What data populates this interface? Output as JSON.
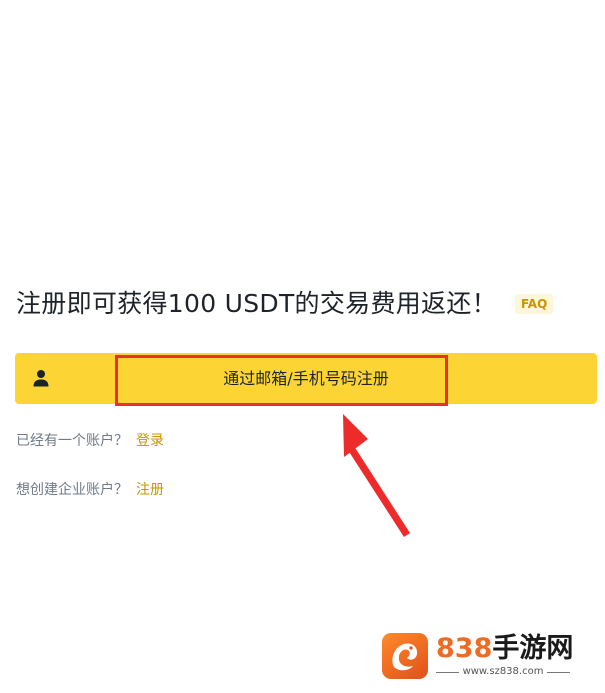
{
  "headline": {
    "text": "注册即可获得100 USDT的交易费用返还！",
    "faq_label": "FAQ"
  },
  "signup": {
    "label": "通过邮箱/手机号码注册",
    "icon": "user-icon"
  },
  "login_prompt": {
    "text": "已经有一个账户？",
    "link": "登录"
  },
  "business_prompt": {
    "text": "想创建企业账户？",
    "link": "注册"
  },
  "watermark": {
    "brand_number": "838",
    "brand_text": "手游网",
    "url": "www.sz838.com"
  },
  "colors": {
    "primary_yellow": "#fcd535",
    "link_gold": "#c99400",
    "highlight_red": "#e8312b",
    "text_dark": "#1e2329",
    "text_muted": "#707a8a"
  }
}
